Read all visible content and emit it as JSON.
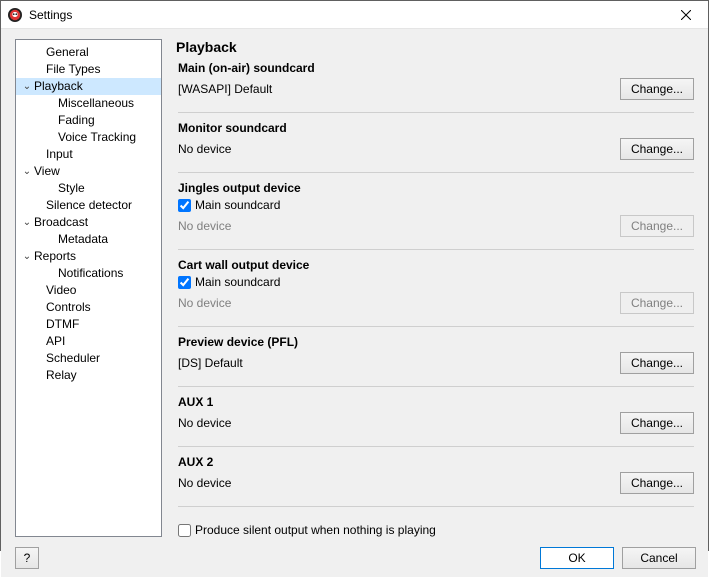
{
  "window": {
    "title": "Settings"
  },
  "nav": {
    "items": [
      {
        "label": "General",
        "indent": "indent1nocaret",
        "caret": ""
      },
      {
        "label": "File Types",
        "indent": "indent1nocaret",
        "caret": ""
      },
      {
        "label": "Playback",
        "indent": "indent1",
        "caret": "⌄",
        "selected": true
      },
      {
        "label": "Miscellaneous",
        "indent": "indent2",
        "caret": ""
      },
      {
        "label": "Fading",
        "indent": "indent2",
        "caret": ""
      },
      {
        "label": "Voice Tracking",
        "indent": "indent2",
        "caret": ""
      },
      {
        "label": "Input",
        "indent": "indent1nocaret",
        "caret": ""
      },
      {
        "label": "View",
        "indent": "indent1",
        "caret": "⌄"
      },
      {
        "label": "Style",
        "indent": "indent2",
        "caret": ""
      },
      {
        "label": "Silence detector",
        "indent": "indent1nocaret",
        "caret": ""
      },
      {
        "label": "Broadcast",
        "indent": "indent1",
        "caret": "⌄"
      },
      {
        "label": "Metadata",
        "indent": "indent2",
        "caret": ""
      },
      {
        "label": "Reports",
        "indent": "indent1",
        "caret": "⌄"
      },
      {
        "label": "Notifications",
        "indent": "indent2",
        "caret": ""
      },
      {
        "label": "Video",
        "indent": "indent1nocaret",
        "caret": ""
      },
      {
        "label": "Controls",
        "indent": "indent1nocaret",
        "caret": ""
      },
      {
        "label": "DTMF",
        "indent": "indent1nocaret",
        "caret": ""
      },
      {
        "label": "API",
        "indent": "indent1nocaret",
        "caret": ""
      },
      {
        "label": "Scheduler",
        "indent": "indent1nocaret",
        "caret": ""
      },
      {
        "label": "Relay",
        "indent": "indent1nocaret",
        "caret": ""
      }
    ]
  },
  "page": {
    "title": "Playback",
    "change_label": "Change...",
    "main_checkbox_label": "Main soundcard",
    "sections": {
      "main": {
        "title": "Main (on-air) soundcard",
        "value": "[WASAPI] Default"
      },
      "monitor": {
        "title": "Monitor soundcard",
        "value": "No device"
      },
      "jingles": {
        "title": "Jingles output device",
        "value": "No device"
      },
      "cart": {
        "title": "Cart wall output device",
        "value": "No device"
      },
      "preview": {
        "title": "Preview device (PFL)",
        "value": "[DS] Default"
      },
      "aux1": {
        "title": "AUX 1",
        "value": "No device"
      },
      "aux2": {
        "title": "AUX 2",
        "value": "No device"
      }
    },
    "silent_output_label": "Produce silent output when nothing is playing"
  },
  "footer": {
    "help": "?",
    "ok": "OK",
    "cancel": "Cancel"
  }
}
